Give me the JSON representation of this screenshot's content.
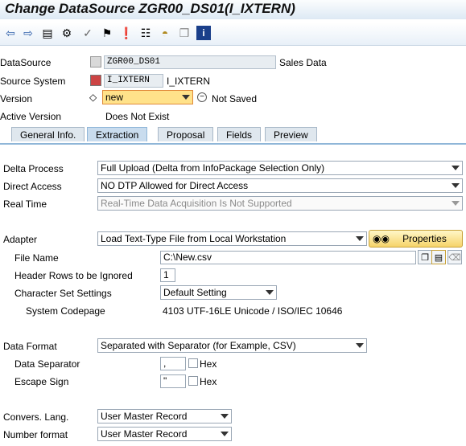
{
  "title": "Change DataSource ZGR00_DS01(I_IXTERN)",
  "toolbar": {
    "icons": [
      "back-icon",
      "forward-icon",
      "display-change-icon",
      "hierarchy-icon",
      "check-icon",
      "activate-icon",
      "where-used-icon",
      "structure-icon",
      "database-icon",
      "object-icon",
      "info-icon"
    ]
  },
  "header": {
    "datasource_label": "DataSource",
    "datasource_value": "ZGR00_DS01",
    "datasource_desc": "Sales Data",
    "source_system_label": "Source System",
    "source_system_value": "I_IXTERN",
    "source_system_desc": "I_IXTERN",
    "version_label": "Version",
    "version_value": "new",
    "version_status": "Not Saved",
    "active_version_label": "Active Version",
    "active_version_value": "Does Not Exist"
  },
  "tabs": [
    "General Info.",
    "Extraction",
    "Proposal",
    "Fields",
    "Preview"
  ],
  "extraction": {
    "delta_process_label": "Delta Process",
    "delta_process_value": "Full Upload (Delta from InfoPackage Selection Only)",
    "direct_access_label": "Direct Access",
    "direct_access_value": "NO DTP Allowed for Direct Access",
    "real_time_label": "Real Time",
    "real_time_value": "Real-Time Data Acquisition Is Not Supported",
    "adapter_label": "Adapter",
    "adapter_value": "Load Text-Type File from Local Workstation",
    "properties_label": "Properties",
    "file_name_label": "File Name",
    "file_name_value": "C:\\New.csv",
    "header_rows_label": "Header Rows to be Ignored",
    "header_rows_value": "1",
    "charset_label": "Character Set Settings",
    "charset_value": "Default Setting",
    "codepage_label": "System Codepage",
    "codepage_value": "4103  UTF-16LE Unicode / ISO/IEC 10646",
    "data_format_label": "Data Format",
    "data_format_value": "Separated with Separator (for Example, CSV)",
    "data_separator_label": "Data Separator",
    "data_separator_value": ",",
    "escape_sign_label": "Escape Sign",
    "escape_sign_value": "\"",
    "hex_label": "Hex",
    "convers_lang_label": "Convers. Lang.",
    "convers_lang_value": "User Master Record",
    "number_format_label": "Number format",
    "number_format_value": "User Master Record"
  }
}
